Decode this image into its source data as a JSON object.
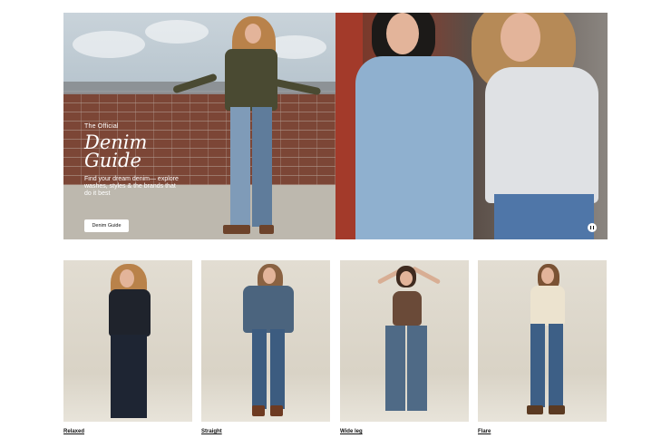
{
  "hero": {
    "eyebrow": "The Official",
    "title_line1": "Denim",
    "title_line2": "Guide",
    "description": "Find your dream denim— explore washes, styles & the brands that do it best",
    "button_label": "Denim Guide",
    "pause_icon": "pause-icon"
  },
  "categories": [
    {
      "label": "Relaxed"
    },
    {
      "label": "Straight"
    },
    {
      "label": "Wide leg"
    },
    {
      "label": "Flare"
    }
  ],
  "colors": {
    "background": "#ffffff",
    "button_bg": "#ffffff",
    "text": "#111111"
  }
}
